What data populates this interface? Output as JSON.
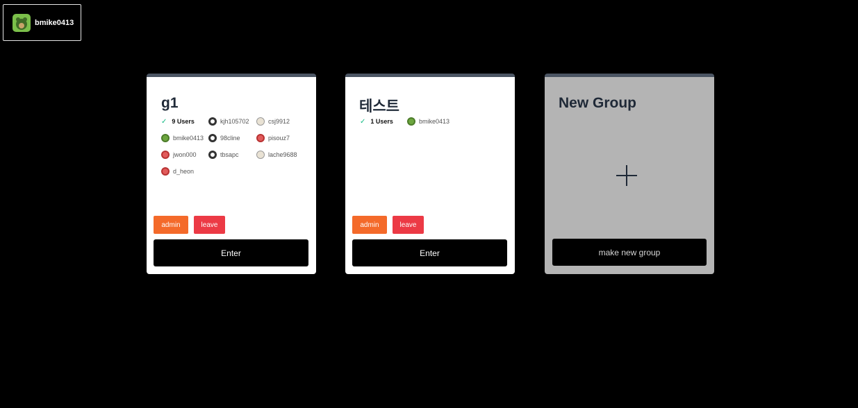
{
  "user": {
    "name": "bmike0413",
    "avatar_icon": "bear-avatar-icon"
  },
  "groups": [
    {
      "title": "g1",
      "users_count_label": "9 Users",
      "members": [
        "kjh105702",
        "csj9912",
        "bmike0413",
        "98cline",
        "pisouz7",
        "jwon000",
        "tbsapc",
        "lache9688",
        "d_heon"
      ],
      "admin_label": "admin",
      "leave_label": "leave",
      "enter_label": "Enter"
    },
    {
      "title": "테스트",
      "users_count_label": "1 Users",
      "members": [
        "bmike0413"
      ],
      "admin_label": "admin",
      "leave_label": "leave",
      "enter_label": "Enter"
    }
  ],
  "new_group": {
    "title": "New Group",
    "add_icon": "plus-icon",
    "button_label": "make new group"
  },
  "colors": {
    "admin": "#f46a2a",
    "leave": "#ec3a45",
    "card_border": "#4b5563",
    "new_group_bg": "#b4b4b4"
  }
}
